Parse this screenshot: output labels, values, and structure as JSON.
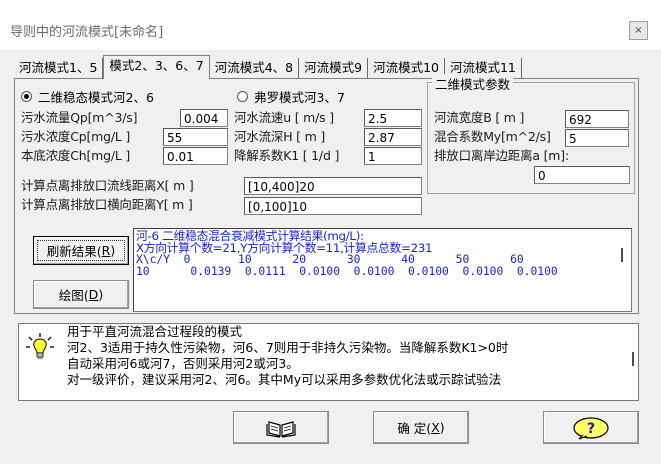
{
  "window": {
    "title": "导则中的河流模式[未命名]",
    "close": "×"
  },
  "tabs": [
    {
      "label": "河流模式1、5",
      "active": false
    },
    {
      "label": "模式2、3、6、7",
      "active": true
    },
    {
      "label": "河流模式4、8",
      "active": false
    },
    {
      "label": "河流模式9",
      "active": false
    },
    {
      "label": "河流模式10",
      "active": false
    },
    {
      "label": "河流模式11",
      "active": false
    }
  ],
  "modes": {
    "steady": "二维稳态模式河2、6",
    "fokker": "弗罗模式河3、7",
    "selected": "steady"
  },
  "left_params": [
    {
      "label": "污水流量Qp[m^3/s]",
      "value": "0.004"
    },
    {
      "label": "污水浓度Cp[mg/L ]",
      "value": "55"
    },
    {
      "label": "本底浓度Ch[mg/L ]",
      "value": "0.01"
    }
  ],
  "mid_params": [
    {
      "label": "河水流速u [ m/s ]",
      "value": "2.5"
    },
    {
      "label": "河水流深H [ m  ]",
      "value": "2.87"
    },
    {
      "label": "降解系数K1 [ 1/d ]",
      "value": "1"
    }
  ],
  "group2d": {
    "title": "二维模式参数",
    "width_label": "河流宽度B [ m  ]",
    "width_value": "692",
    "my_label": "混合系数My[m^2/s]",
    "my_value": "5",
    "dist_label": "排放口离岸边距离a [m]:",
    "dist_value": "0"
  },
  "distance": {
    "x_label": "计算点离排放口流线距离X[ m ]",
    "x_value": "[10,400]20",
    "y_label": "计算点离排放口横向距离Y[ m ]",
    "y_value": "[0,100]10"
  },
  "buttons": {
    "refresh": "刷新结果(",
    "refresh_key": "R",
    "plot": "绘图(",
    "plot_key": "D",
    "ok": "确 定(",
    "ok_key": "X",
    "close_paren": ")"
  },
  "results": {
    "title": "河-6 二维稳态混合衰减模式计算结果(mg/L):",
    "summary": "X方向计算个数=21,Y方向计算个数=11,计算点总数=231",
    "header": "X\\c/Y  0       10      20      30      40      50      60",
    "row": "10      0.0139  0.0111  0.0100  0.0100  0.0100  0.0100  0.0100"
  },
  "info": {
    "lines": [
      "用于平直河流混合过程段的模式",
      "    河2、3适用于持久性污染物，河6、7则用于非持久污染物。当降解系数K1>0时",
      "自动采用河6或河7，否则采用河2或河3。",
      "    对一级评价，建议采用河2、河6。其中My可以采用多参数优化法或示踪试验法"
    ]
  },
  "icons": {
    "bulb": "lightbulb-icon",
    "book": "book-icon",
    "help": "help-icon"
  }
}
